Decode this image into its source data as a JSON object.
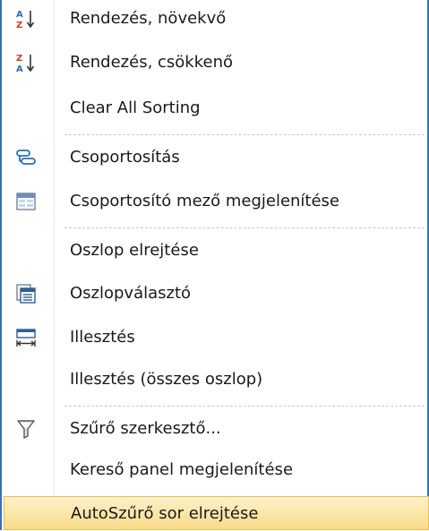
{
  "menu": {
    "items": [
      {
        "label": "Rendezés, növekvő",
        "icon": "sort-ascending-icon"
      },
      {
        "label": "Rendezés, csökkenő",
        "icon": "sort-descending-icon"
      },
      {
        "label": "Clear All Sorting",
        "icon": ""
      },
      {
        "label": "Csoportosítás",
        "icon": "group-by-icon"
      },
      {
        "label": "Csoportosító mező megjelenítése",
        "icon": "group-panel-icon"
      },
      {
        "label": "Oszlop elrejtése",
        "icon": ""
      },
      {
        "label": "Oszlopválasztó",
        "icon": "column-chooser-icon"
      },
      {
        "label": "Illesztés",
        "icon": "best-fit-icon"
      },
      {
        "label": "Illesztés (összes oszlop)",
        "icon": ""
      },
      {
        "label": "Szűrő szerkesztő...",
        "icon": "filter-icon"
      },
      {
        "label": "Kereső panel megjelenítése",
        "icon": ""
      },
      {
        "label": "AutoSzűrő sor elrejtése",
        "icon": ""
      }
    ],
    "highlighted_item": "AutoSzűrő sor elrejtése",
    "colors": {
      "border": "#3b6fb6",
      "highlight_top": "#fdf1c9",
      "highlight_bottom": "#f9dc8a",
      "icon_blue": "#2f6db5",
      "icon_red": "#d03a2a"
    }
  }
}
